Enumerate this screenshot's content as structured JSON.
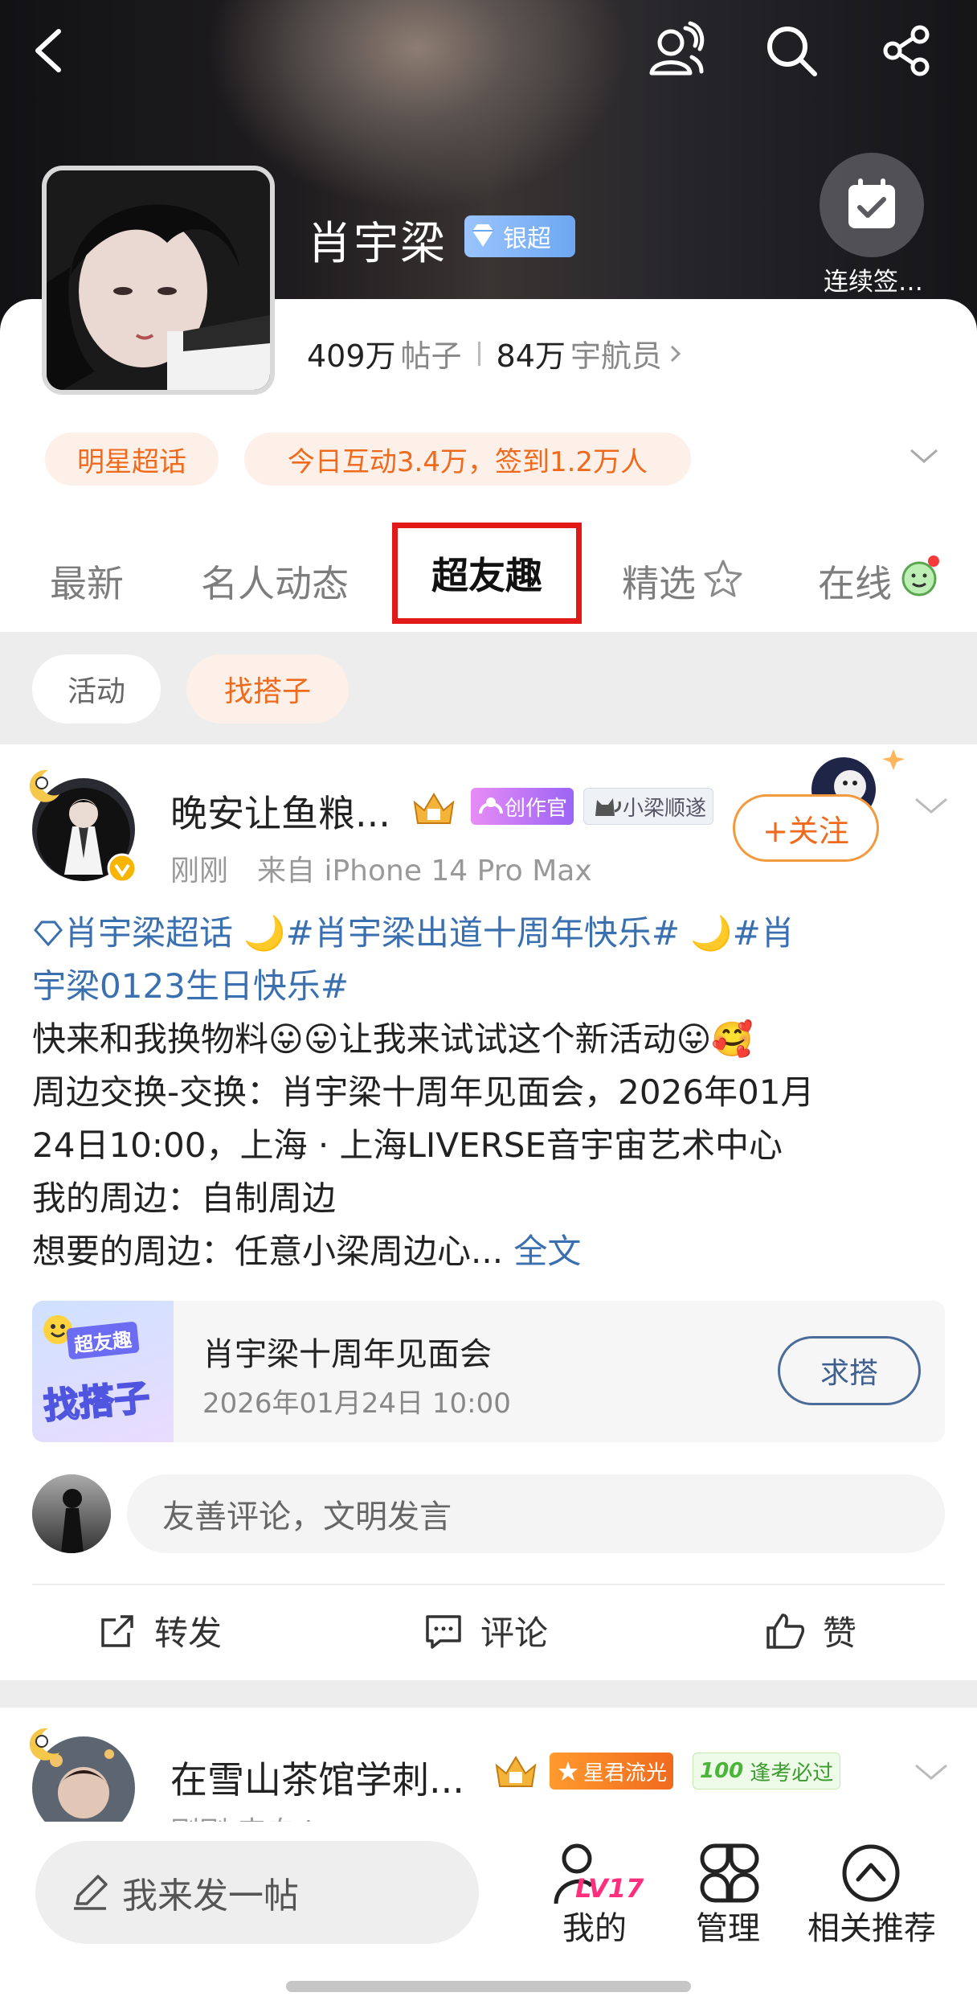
{
  "header": {
    "title": "肖宇梁",
    "badge": "银超",
    "checkin_label": "连续签…",
    "stats": {
      "posts_count": "409万",
      "posts_label": "帖子",
      "members_count": "84万",
      "members_label": "宇航员"
    }
  },
  "pills": [
    "明星超话",
    "今日互动3.4万，签到1.2万人"
  ],
  "tabs": [
    "最新",
    "名人动态",
    "超友趣",
    "精选",
    "在线"
  ],
  "subtabs": [
    "活动",
    "找搭子"
  ],
  "post1": {
    "username": "晚安让鱼粮...",
    "chip_creator": "创作官",
    "chip_fan": "小梁顺遂",
    "follow": "+关注",
    "time": "刚刚",
    "source": "来自 iPhone 14 Pro Max",
    "line1": "肖宇梁超话  🌙#肖宇梁出道十周年快乐# 🌙#肖",
    "line2": "宇梁0123生日快乐#",
    "line3": "快来和我换物料😛😛让我来试试这个新活动😛🥰",
    "line4": "周边交换-交换：肖宇梁十周年见面会，2026年01月",
    "line5": "24日10:00，上海 · 上海LIVERSE音宇宙艺术中心",
    "line6": "我的周边：自制周边",
    "line7": "想要的周边：任意小梁周边心... ",
    "fulltext": "全文",
    "card_title": "肖宇梁十周年见面会",
    "card_date": "2026年01月24日 10:00",
    "card_button": "求搭",
    "card_img_top": "超友趣",
    "card_img_bottom": "找搭子",
    "comment_placeholder": "友善评论，文明发言",
    "actions": [
      "转发",
      "评论",
      "赞"
    ]
  },
  "post2": {
    "username": "在雪山茶馆学刺...",
    "chip1": "星君流光",
    "chip2": "逢考必过",
    "chip2_icon": "100",
    "time_partial": "刚刚  来自 i"
  },
  "bottom": {
    "compose": "我来发一帖",
    "level": "LV17",
    "items": [
      "我的",
      "管理",
      "相关推荐"
    ]
  },
  "colors": {
    "accent": "#f06a1e",
    "link": "#3a6fb0",
    "highlight": "#e11919"
  }
}
